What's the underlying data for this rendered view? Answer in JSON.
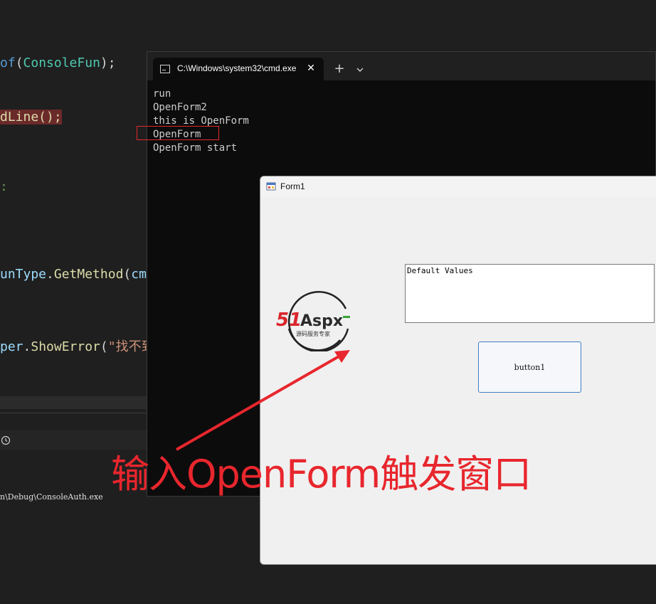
{
  "editor": {
    "lines": [
      {
        "kw": "of",
        "p1": "(",
        "ty": "ConsoleFun",
        "p2": ");"
      },
      {
        "hl": "dLine();"
      },
      {
        "cm": ":"
      },
      {
        "vr": "unType",
        "p1": ".",
        "fn": "GetMethod",
        "p2": "(",
        "vr2": "cmd"
      },
      {
        "vr": "per",
        "p1": ".",
        "fn": "ShowError",
        "p2": "(",
        "st": "\"找不到"
      }
    ],
    "output_path": "n\\Debug\\ConsoleAuth.exe"
  },
  "cmd": {
    "tab_title": "C:\\Windows\\system32\\cmd.exe",
    "close_glyph": "✕",
    "new_tab_glyph": "+",
    "output_lines": [
      "run",
      "OpenForm2",
      "this is OpenForm",
      "OpenForm",
      "OpenForm start"
    ]
  },
  "form": {
    "title": "Form1",
    "textbox_value": "Default Values",
    "button_label": "button1",
    "logo": {
      "brand_51": "51",
      "brand_aspx": "Aspx",
      "tagline": "源码服务专家"
    }
  },
  "annotation": {
    "text": "输入OpenForm触发窗口",
    "color": "#e8262d"
  }
}
